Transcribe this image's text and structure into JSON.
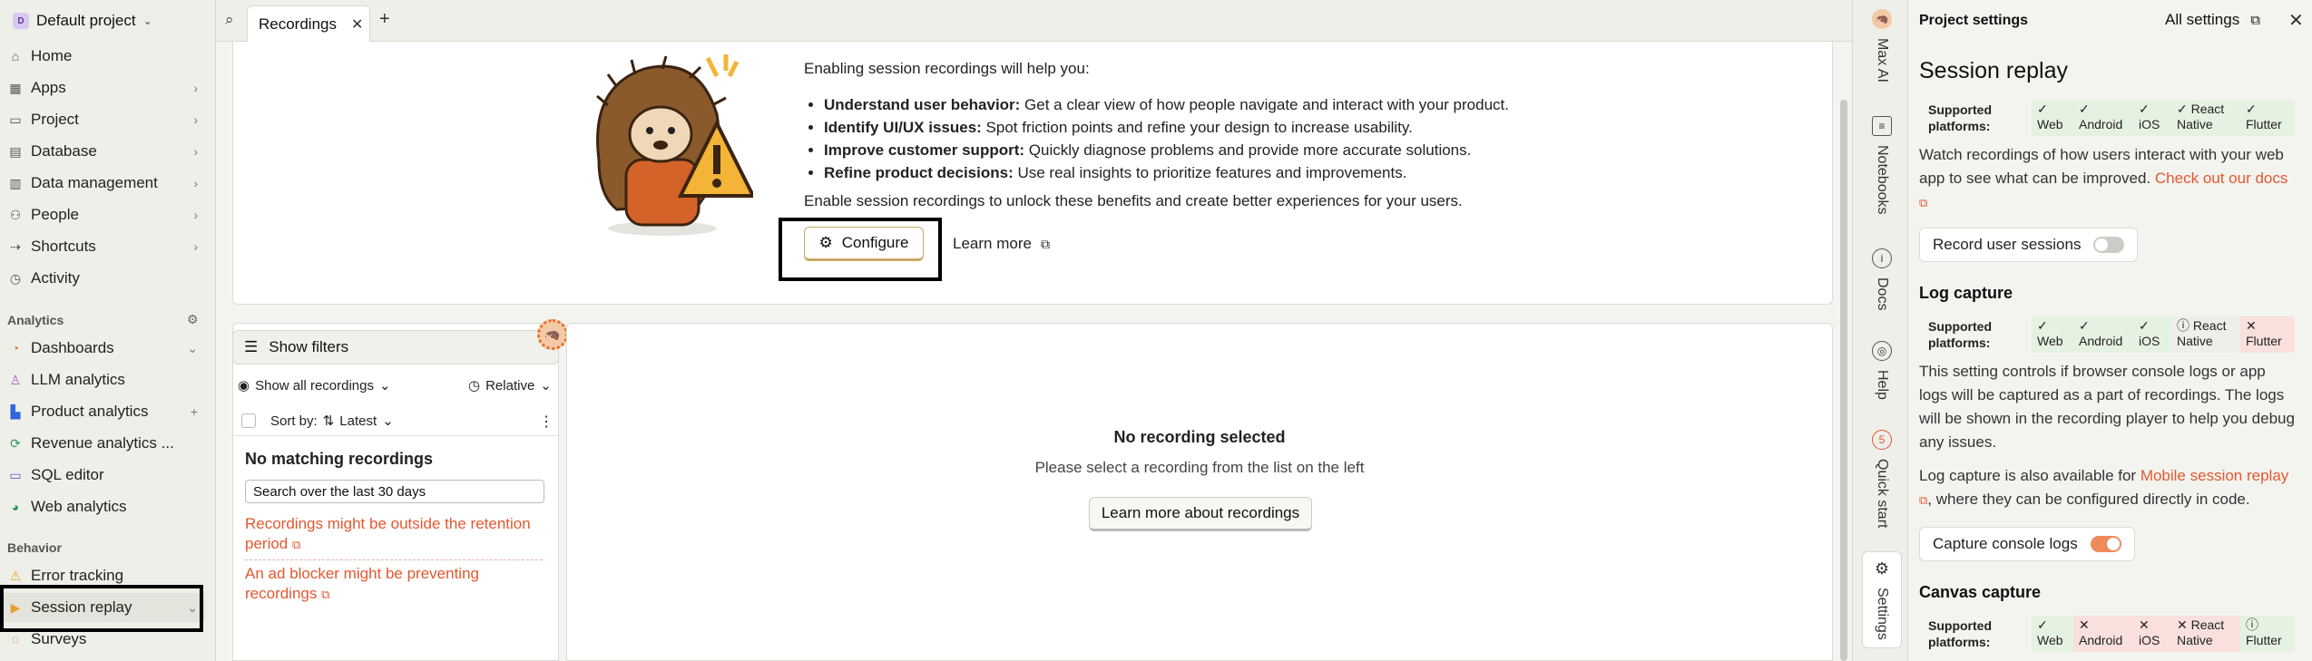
{
  "project": {
    "avatar_letter": "D",
    "name": "Default project"
  },
  "sidebar": {
    "items": [
      {
        "label": "Home",
        "icon": "home-icon"
      },
      {
        "label": "Apps",
        "icon": "apps-icon"
      },
      {
        "label": "Project",
        "icon": "folder-icon"
      },
      {
        "label": "Database",
        "icon": "database-icon"
      },
      {
        "label": "Data management",
        "icon": "data-icon"
      },
      {
        "label": "People",
        "icon": "people-icon"
      },
      {
        "label": "Shortcuts",
        "icon": "shortcut-icon"
      },
      {
        "label": "Activity",
        "icon": "clock-icon"
      }
    ],
    "analytics_label": "Analytics",
    "analytics_items": [
      {
        "label": "Dashboards"
      },
      {
        "label": "LLM analytics"
      },
      {
        "label": "Product analytics"
      },
      {
        "label": "Revenue analytics ..."
      },
      {
        "label": "SQL editor"
      },
      {
        "label": "Web analytics"
      }
    ],
    "behavior_label": "Behavior",
    "behavior_items": [
      {
        "label": "Error tracking"
      },
      {
        "label": "Session replay"
      },
      {
        "label": "Surveys"
      }
    ]
  },
  "tabs": {
    "active": "Recordings"
  },
  "banner": {
    "intro": "Enabling session recordings will help you:",
    "benefits": [
      {
        "title": "Understand user behavior:",
        "text": " Get a clear view of how people navigate and interact with your product."
      },
      {
        "title": "Identify UI/UX issues:",
        "text": " Spot friction points and refine your design to increase usability."
      },
      {
        "title": "Improve customer support:",
        "text": " Quickly diagnose problems and provide more accurate solutions."
      },
      {
        "title": "Refine product decisions:",
        "text": " Use real insights to prioritize features and improvements."
      }
    ],
    "footer": "Enable session recordings to unlock these benefits and create better experiences for your users.",
    "configure_label": "Configure",
    "learn_more_label": "Learn more"
  },
  "list": {
    "show_filters": "Show filters",
    "show_all": "Show all recordings",
    "relative": "Relative",
    "sort_by": "Sort by:",
    "sort_value": "Latest",
    "no_match": "No matching recordings",
    "search_over": "Search over the last 30 days",
    "warn1": "Recordings might be outside the retention period",
    "warn2": "An ad blocker might be preventing recordings"
  },
  "player": {
    "title": "No recording selected",
    "subtitle": "Please select a recording from the list on the left",
    "button": "Learn more about recordings"
  },
  "vtabs": {
    "max_ai": "Max AI",
    "notebooks": "Notebooks",
    "docs": "Docs",
    "help": "Help",
    "quick_start": "Quick start",
    "quick_start_count": "5",
    "settings": "Settings"
  },
  "panel": {
    "header": "Project settings",
    "all_settings": "All settings",
    "title": "Session replay",
    "supported_label": "Supported platforms:",
    "replay_platforms": [
      "✓ Web",
      "✓ Android",
      "✓ iOS",
      "✓ React Native",
      "✓ Flutter"
    ],
    "replay_desc": "Watch recordings of how users interact with your web app to see what can be improved.",
    "docs_link": "Check out our docs",
    "record_toggle": "Record user sessions",
    "log_title": "Log capture",
    "log_platforms": [
      "✓ Web",
      "✓ Android",
      "✓ iOS",
      "ⓘ React Native",
      "✕ Flutter"
    ],
    "log_desc": "This setting controls if browser console logs or app logs will be captured as a part of recordings. The logs will be shown in the recording player to help you debug any issues.",
    "log_mobile_prefix": "Log capture is also available for ",
    "log_mobile_link": "Mobile session replay",
    "log_mobile_suffix": ", where they can be configured directly in code.",
    "console_toggle": "Capture console logs",
    "canvas_title": "Canvas capture",
    "canvas_platforms": [
      "✓ Web",
      "✕ Android",
      "✕ iOS",
      "✕ React Native",
      "ⓘ Flutter"
    ]
  }
}
